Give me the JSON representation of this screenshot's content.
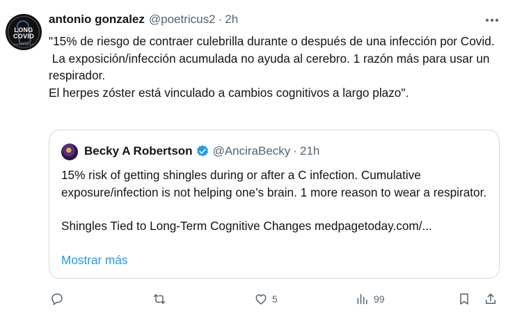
{
  "tweet": {
    "author_name": "antonio gonzalez",
    "author_handle": "@poetricus2",
    "separator": "·",
    "time": "2h",
    "avatar_text": {
      "line1": "LONG",
      "line2": "COVID",
      "caption": "AWARENESS"
    },
    "text": "\"15% de riesgo de contraer culebrilla durante o después de una infección por Covid.\n La exposición/infección acumulada no ayuda al cerebro. 1 razón más para usar un respirador.\nEl herpes zóster está vinculado a cambios cognitivos a largo plazo\"."
  },
  "quoted": {
    "author_name": "Becky A Robertson",
    "author_handle": "@AnciraBecky",
    "separator": "·",
    "time": "21h",
    "paragraph1": "15% risk of getting shingles during or after a C infection. Cumulative exposure/infection is not helping one’s brain. 1 more reason to wear a respirator.",
    "paragraph2": "Shingles Tied to Long-Term Cognitive Changes medpagetoday.com/...",
    "show_more": "Mostrar más"
  },
  "actions": {
    "reply_count": "",
    "retweet_count": "",
    "like_count": "5",
    "views_count": "99"
  },
  "icons": [
    "more-icon",
    "verified-badge-icon",
    "reply-icon",
    "retweet-icon",
    "like-icon",
    "views-icon",
    "bookmark-icon",
    "share-icon"
  ],
  "colors": {
    "link": "#1d9bf0",
    "secondary_text": "#536471",
    "border": "#cfd9de",
    "verified": "#1d9bf0"
  }
}
